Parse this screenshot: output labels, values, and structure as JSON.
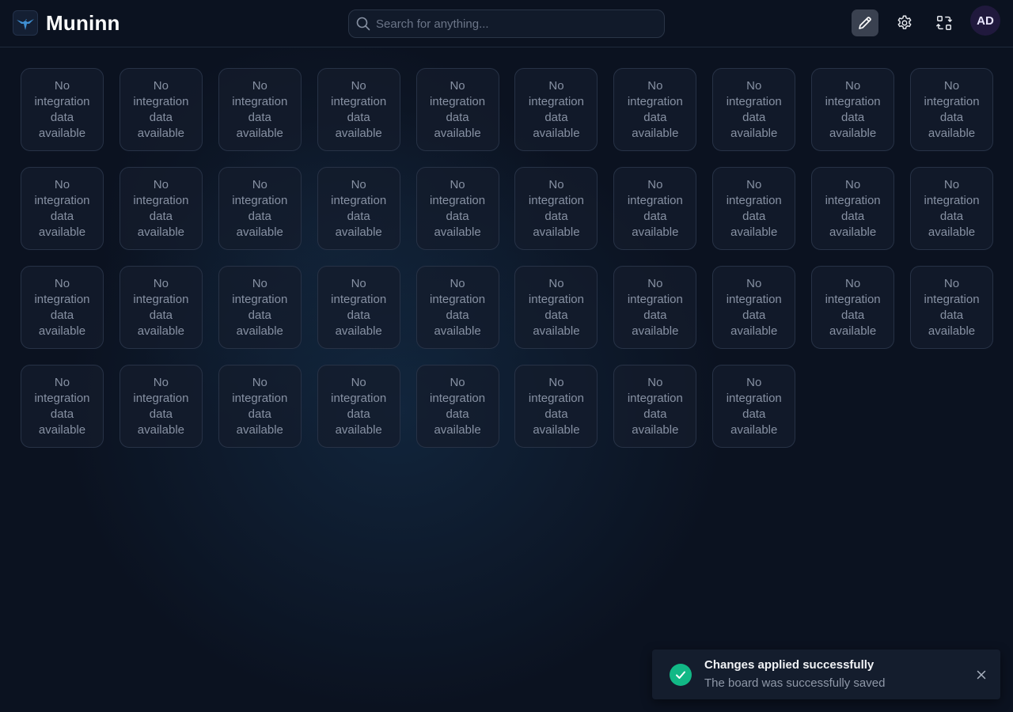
{
  "app": {
    "name": "Muninn",
    "logo_icon": "raven-icon"
  },
  "search": {
    "placeholder": "Search for anything..."
  },
  "header_actions": [
    {
      "icon": "pencil-icon",
      "active": true
    },
    {
      "icon": "gear-icon"
    },
    {
      "icon": "switch-arrows-icon"
    }
  ],
  "user": {
    "initials": "AD"
  },
  "board": {
    "tile_text": "No integration data available",
    "tile_count": 38
  },
  "toast": {
    "title": "Changes applied successfully",
    "message": "The board was successfully saved",
    "status_icon": "check-icon",
    "close_icon": "close-icon",
    "accent": "#12b886"
  },
  "colors": {
    "background": "#0b1220",
    "tile_border": "#273246",
    "tile_text": "#8791a3",
    "avatar_bg": "#20193d"
  }
}
